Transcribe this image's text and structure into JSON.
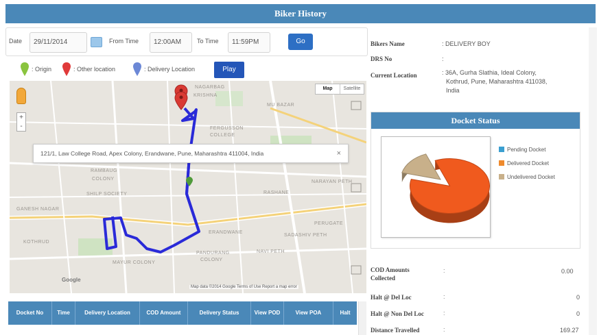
{
  "header": {
    "title": "Biker History"
  },
  "filter": {
    "date_label": "Date",
    "date_value": "29/11/2014",
    "from_label": "From Time",
    "from_value": "12:00AM",
    "to_label": "To Time",
    "to_value": "11:59PM",
    "go_label": "Go"
  },
  "legend": {
    "origin": ": Origin",
    "other": ": Other location",
    "delivery": ": Delivery Location",
    "play_label": "Play"
  },
  "map": {
    "type_map": "Map",
    "type_satellite": "Satellite",
    "zoom_in": "+",
    "zoom_out": "-",
    "info_address": "121/1, Law College Road, Apex Colony, Erandwane, Pune, Maharashtra 411004, India",
    "info_close": "×",
    "footer": "Map data ©2014 Google   Terms of Use   Report a map error",
    "google": "Google",
    "labels": {
      "l1": "NAGARBAG",
      "l2": "KRISHNA",
      "l3": "MU BAZAR",
      "l4": "FERGUSSON",
      "l5": "COLLEGE",
      "l6": "RAMBAUG",
      "l7": "COLONY",
      "l8": "SHILP SOCIETY",
      "l9": "NARAYAN PETH",
      "l10": "RASHANE",
      "l11": "PERUGATE",
      "l12": "SADASHIV PETH",
      "l13": "PANDURANG",
      "l14": "COLONY",
      "l15": "NAVI PETH",
      "l16": "KOTHRUD",
      "l17": "ERANDWANE",
      "l18": "MAYUR COLONY",
      "l19": "GANESH NAGAR"
    }
  },
  "table": {
    "headers": [
      "Docket No",
      "Time",
      "Delivery Location",
      "COD Amount",
      "Delivery Status",
      "View POD",
      "View POA",
      "Halt"
    ]
  },
  "biker": {
    "name_label": "Bikers Name",
    "name_value": ": DELIVERY BOY",
    "drs_label": "DRS No",
    "drs_value": ":",
    "loc_label": "Current Location",
    "loc_value_1": ": 36A, Gurha Slathia, Ideal Colony,",
    "loc_value_2": "Kothrud, Pune, Maharashtra 411038,",
    "loc_value_3": "India"
  },
  "docket": {
    "title": "Docket Status",
    "legend": [
      "Pending Docket",
      "Delivered Docket",
      "Undelivered Docket"
    ],
    "colors": {
      "pending": "#3a9fd0",
      "delivered": "#ef8a2d",
      "undelivered": "#c8b08a",
      "pie_green": "#33c02b",
      "pie_orange": "#f05a1e"
    }
  },
  "chart_data": {
    "type": "pie",
    "categories": [
      "Pending Docket",
      "Delivered Docket",
      "Undelivered Docket"
    ],
    "values": [
      0,
      85,
      15
    ],
    "colors": [
      "#33c02b",
      "#f05a1e",
      "#c8b08a"
    ]
  },
  "stats": {
    "cod_label": "COD Amounts Collected",
    "cod_value": "0.00",
    "halt_del_label": "Halt @ Del Loc",
    "halt_del_value": "0",
    "halt_nondel_label": "Halt @ Non Del Loc",
    "halt_nondel_value": "0",
    "dist_label": "Distance Travelled",
    "dist_value": "169.27"
  }
}
